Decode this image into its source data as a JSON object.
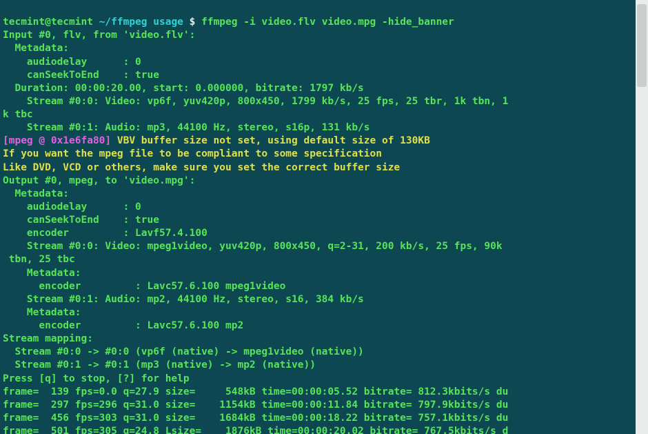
{
  "prompt": {
    "user": "tecmint@tecmint",
    "sep1": " ",
    "path": "~/ffmpeg usage",
    "sep2": " $ ",
    "cmd": "ffmpeg -i video.flv video.mpg -hide_banner"
  },
  "out": {
    "l01": "Input #0, flv, from 'video.flv':",
    "l02": "  Metadata:",
    "l03": "    audiodelay      : 0",
    "l04": "    canSeekToEnd    : true",
    "l05": "  Duration: 00:00:20.00, start: 0.000000, bitrate: 1797 kb/s",
    "l06": "    Stream #0:0: Video: vp6f, yuv420p, 800x450, 1799 kb/s, 25 fps, 25 tbr, 1k tbn, 1",
    "l06b": "k tbc",
    "l07": "    Stream #0:1: Audio: mp3, 44100 Hz, stereo, s16p, 131 kb/s",
    "warn_tag": "[mpeg @ 0x1e6fa80]",
    "warn_msg": " VBV buffer size not set, using default size of 130KB",
    "l09": "If you want the mpeg file to be compliant to some specification",
    "l10": "Like DVD, VCD or others, make sure you set the correct buffer size",
    "l11": "Output #0, mpeg, to 'video.mpg':",
    "l12": "  Metadata:",
    "l13": "    audiodelay      : 0",
    "l14": "    canSeekToEnd    : true",
    "l15": "    encoder         : Lavf57.4.100",
    "l16": "    Stream #0:0: Video: mpeg1video, yuv420p, 800x450, q=2-31, 200 kb/s, 25 fps, 90k",
    "l16b": " tbn, 25 tbc",
    "l17": "    Metadata:",
    "l18": "      encoder         : Lavc57.6.100 mpeg1video",
    "l19": "    Stream #0:1: Audio: mp2, 44100 Hz, stereo, s16, 384 kb/s",
    "l20": "    Metadata:",
    "l21": "      encoder         : Lavc57.6.100 mp2",
    "l22": "Stream mapping:",
    "l23": "  Stream #0:0 -> #0:0 (vp6f (native) -> mpeg1video (native))",
    "l24": "  Stream #0:1 -> #0:1 (mp3 (native) -> mp2 (native))",
    "l25": "Press [q] to stop, [?] for help",
    "l26": "frame=  139 fps=0.0 q=27.9 size=     548kB time=00:00:05.52 bitrate= 812.3kbits/s du",
    "l27": "frame=  297 fps=296 q=31.0 size=    1154kB time=00:00:11.84 bitrate= 797.9kbits/s du",
    "l28": "frame=  456 fps=303 q=31.0 size=    1684kB time=00:00:18.22 bitrate= 757.1kbits/s du",
    "l29": "frame=  501 fps=305 q=24.8 Lsize=    1876kB time=00:00:20.02 bitrate= 767.5kbits/s d"
  }
}
